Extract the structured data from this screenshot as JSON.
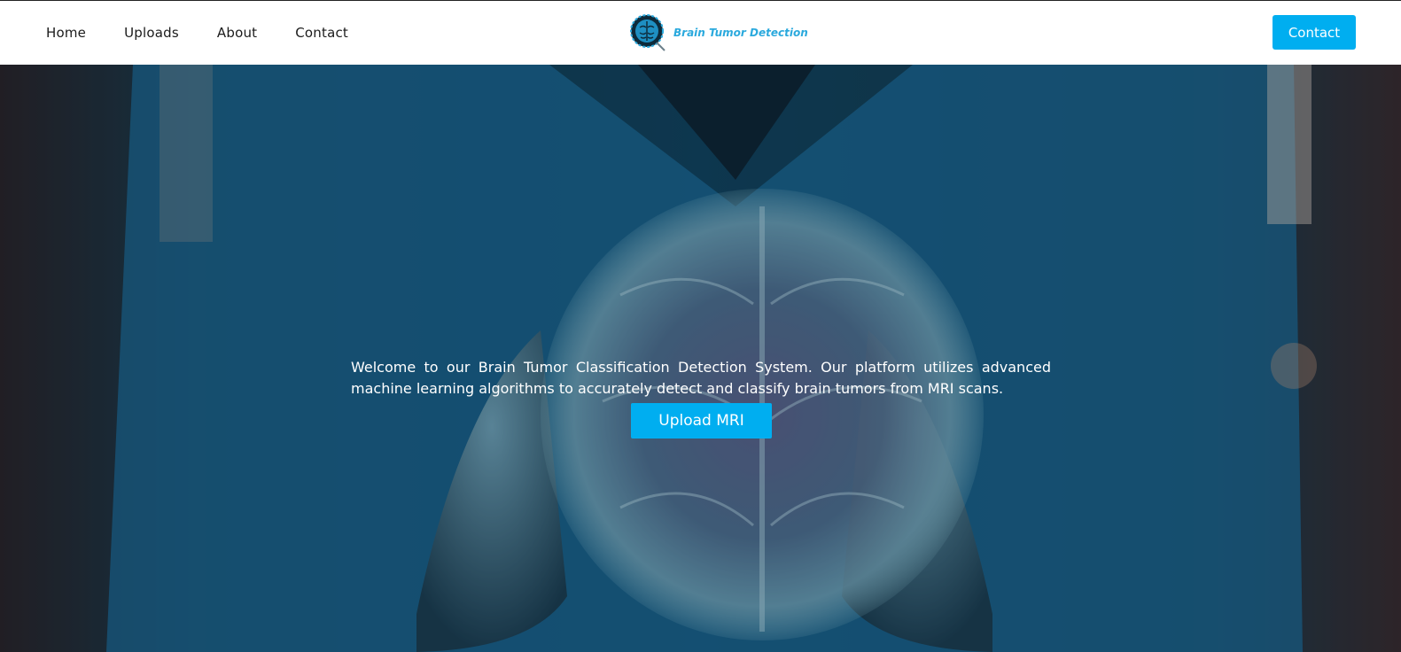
{
  "nav": {
    "links": [
      "Home",
      "Uploads",
      "About",
      "Contact"
    ],
    "brand_text": "Brain Tumor Detection",
    "contact_button": "Contact"
  },
  "hero": {
    "description": "Welcome to our Brain Tumor Classification Detection System. Our platform utilizes advanced machine learning algorithms to accurately detect and classify brain tumors from MRI scans.",
    "upload_button": "Upload MRI"
  },
  "colors": {
    "accent": "#00aef0",
    "brand_text": "#2aa9dd",
    "nav_background": "#ffffff"
  },
  "icons": {
    "logo": "brain-logo-icon"
  }
}
